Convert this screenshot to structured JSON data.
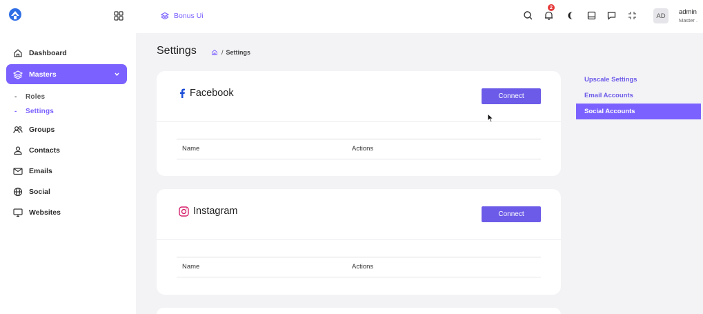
{
  "header": {
    "brand_label": "Bonus Ui",
    "notification_count": "2",
    "avatar_initials": "AD",
    "user_name": "admin",
    "user_role": "Master ."
  },
  "sidebar": {
    "items": [
      {
        "label": "Dashboard",
        "icon": "home-icon"
      },
      {
        "label": "Masters",
        "icon": "layers-icon",
        "active": true
      },
      {
        "label": "Groups",
        "icon": "users-icon"
      },
      {
        "label": "Contacts",
        "icon": "user-icon"
      },
      {
        "label": "Emails",
        "icon": "mail-icon"
      },
      {
        "label": "Social",
        "icon": "globe-icon"
      },
      {
        "label": "Websites",
        "icon": "monitor-icon"
      }
    ],
    "sub_items": [
      {
        "label": "Roles"
      },
      {
        "label": "Settings",
        "active": true
      }
    ]
  },
  "page": {
    "title": "Settings",
    "breadcrumb_sep": "/",
    "breadcrumb_current": "Settings"
  },
  "cards": [
    {
      "title": "Facebook",
      "button": "Connect",
      "col_name": "Name",
      "col_actions": "Actions"
    },
    {
      "title": "Instagram",
      "button": "Connect",
      "col_name": "Name",
      "col_actions": "Actions"
    }
  ],
  "settings_nav": {
    "items": [
      {
        "label": "Upscale Settings"
      },
      {
        "label": "Email Accounts"
      },
      {
        "label": "Social Accounts",
        "active": true
      }
    ]
  },
  "colors": {
    "accent": "#7b61ff",
    "button": "#6c5be8",
    "badge": "#e63a3a"
  }
}
